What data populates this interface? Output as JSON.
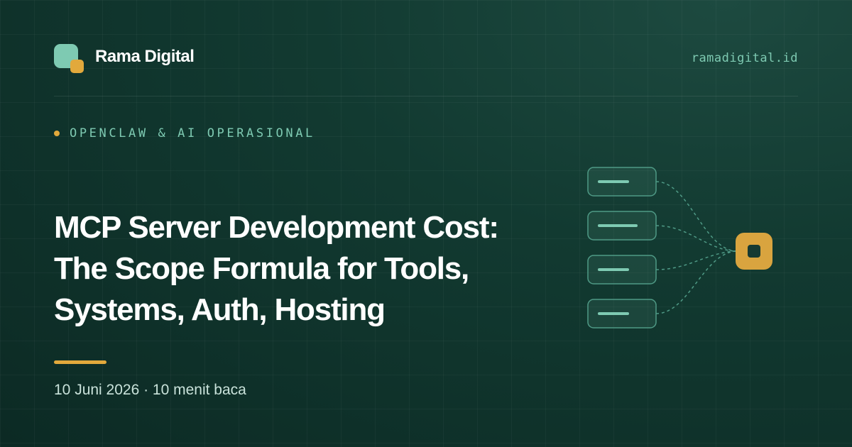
{
  "brand": {
    "name": "Rama Digital",
    "website": "ramadigital.id",
    "logo_icon": "rama-digital-logo-icon"
  },
  "article": {
    "category": "OPENCLAW & AI OPERASIONAL",
    "title": "MCP Server Development Cost: The Scope Formula for Tools, Systems, Auth, Hosting",
    "meta": "10 Juni 2026 · 10 menit baca"
  },
  "illustration": {
    "description_icon": "tools-to-server-connection-diagram",
    "tool_nodes": 4,
    "hub_icon": "mcp-hub-icon"
  },
  "colors": {
    "background": "#123a31",
    "accent_teal": "#7ecab2",
    "accent_gold": "#e2a93c",
    "text_primary": "#ffffff",
    "text_meta": "#c9e2da"
  }
}
